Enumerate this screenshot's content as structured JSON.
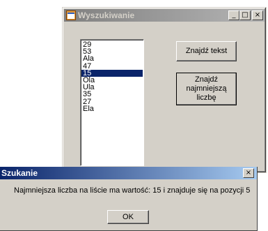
{
  "main_window": {
    "title": "Wyszukiwanie",
    "minimize": "_",
    "maximize": "□",
    "close": "×",
    "list_items": [
      "29",
      "53",
      "Ala",
      "47",
      "15",
      "Ola",
      "Ula",
      "35",
      "27",
      "Ela"
    ],
    "selected_index": 4,
    "find_text_button": "Znajdź tekst",
    "find_min_button_line1": "Znajdź",
    "find_min_button_line2": "najmniejszą liczbę"
  },
  "dialog": {
    "title": "Szukanie",
    "close": "×",
    "message": "Najmniejsza liczba na liście ma wartość: 15 i znajduje się na pozycji 5",
    "ok_button": "OK"
  }
}
